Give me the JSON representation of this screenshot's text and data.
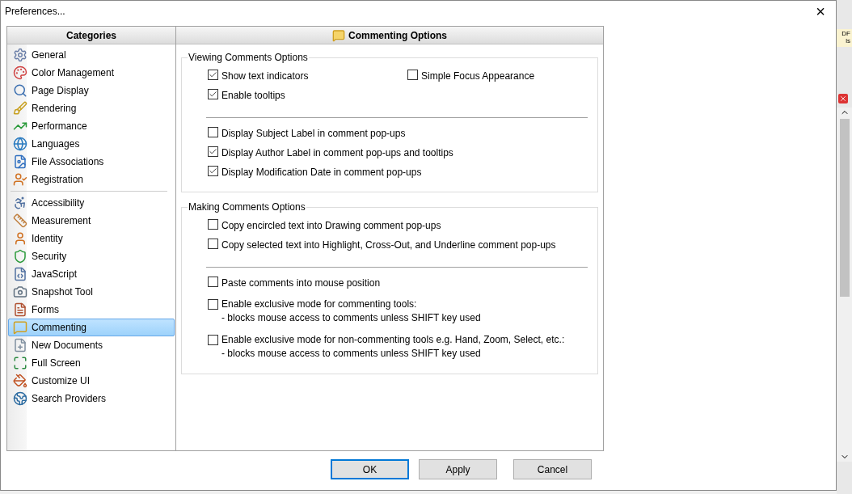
{
  "window": {
    "title": "Preferences...",
    "close": "×"
  },
  "sidebar": {
    "header": "Categories",
    "groups": [
      [
        {
          "label": "General",
          "selected": false
        },
        {
          "label": "Color Management",
          "selected": false
        },
        {
          "label": "Page Display",
          "selected": false
        },
        {
          "label": "Rendering",
          "selected": false
        },
        {
          "label": "Performance",
          "selected": false
        },
        {
          "label": "Languages",
          "selected": false
        },
        {
          "label": "File Associations",
          "selected": false
        },
        {
          "label": "Registration",
          "selected": false
        }
      ],
      [
        {
          "label": "Accessibility",
          "selected": false
        },
        {
          "label": "Measurement",
          "selected": false
        },
        {
          "label": "Identity",
          "selected": false
        },
        {
          "label": "Security",
          "selected": false
        },
        {
          "label": "JavaScript",
          "selected": false
        },
        {
          "label": "Snapshot Tool",
          "selected": false
        },
        {
          "label": "Forms",
          "selected": false
        },
        {
          "label": "Commenting",
          "selected": true
        },
        {
          "label": "New Documents",
          "selected": false
        },
        {
          "label": "Full Screen",
          "selected": false
        },
        {
          "label": "Customize UI",
          "selected": false
        },
        {
          "label": "Search Providers",
          "selected": false
        }
      ]
    ]
  },
  "panel": {
    "title": "Commenting Options",
    "groups": [
      {
        "title": "Viewing Comments Options",
        "sections": [
          [
            [
              {
                "label": "Show text indicators",
                "checked": true
              },
              {
                "label": "Simple Focus Appearance",
                "checked": false
              }
            ],
            [
              {
                "label": "Enable tooltips",
                "checked": true
              }
            ]
          ],
          [
            [
              {
                "label": "Display Subject Label in comment pop-ups",
                "checked": false
              }
            ],
            [
              {
                "label": "Display Author Label in comment pop-ups and tooltips",
                "checked": true
              }
            ],
            [
              {
                "label": "Display Modification Date in comment pop-ups",
                "checked": true
              }
            ]
          ]
        ]
      },
      {
        "title": "Making Comments Options",
        "sections": [
          [
            [
              {
                "label": "Copy encircled text into Drawing comment pop-ups",
                "checked": false
              }
            ],
            [
              {
                "label": "Copy selected text into Highlight, Cross-Out, and Underline comment pop-ups",
                "checked": false
              }
            ]
          ],
          [
            [
              {
                "label": "Paste comments into mouse position",
                "checked": false
              }
            ],
            [
              {
                "label": "Enable exclusive mode for commenting tools:",
                "note": "- blocks mouse access to comments unless SHIFT key used",
                "checked": false
              }
            ],
            [
              {
                "label": "Enable exclusive mode for non-commenting tools e.g. Hand, Zoom, Select, etc.:",
                "note": "- blocks mouse access to comments unless SHIFT key used",
                "checked": false
              }
            ]
          ]
        ]
      }
    ]
  },
  "buttons": [
    {
      "label": "OK",
      "default": true
    },
    {
      "label": "Apply",
      "default": false
    },
    {
      "label": "Cancel",
      "default": false
    }
  ],
  "background_app": {
    "text_1": "DF",
    "text_2": "ls"
  }
}
